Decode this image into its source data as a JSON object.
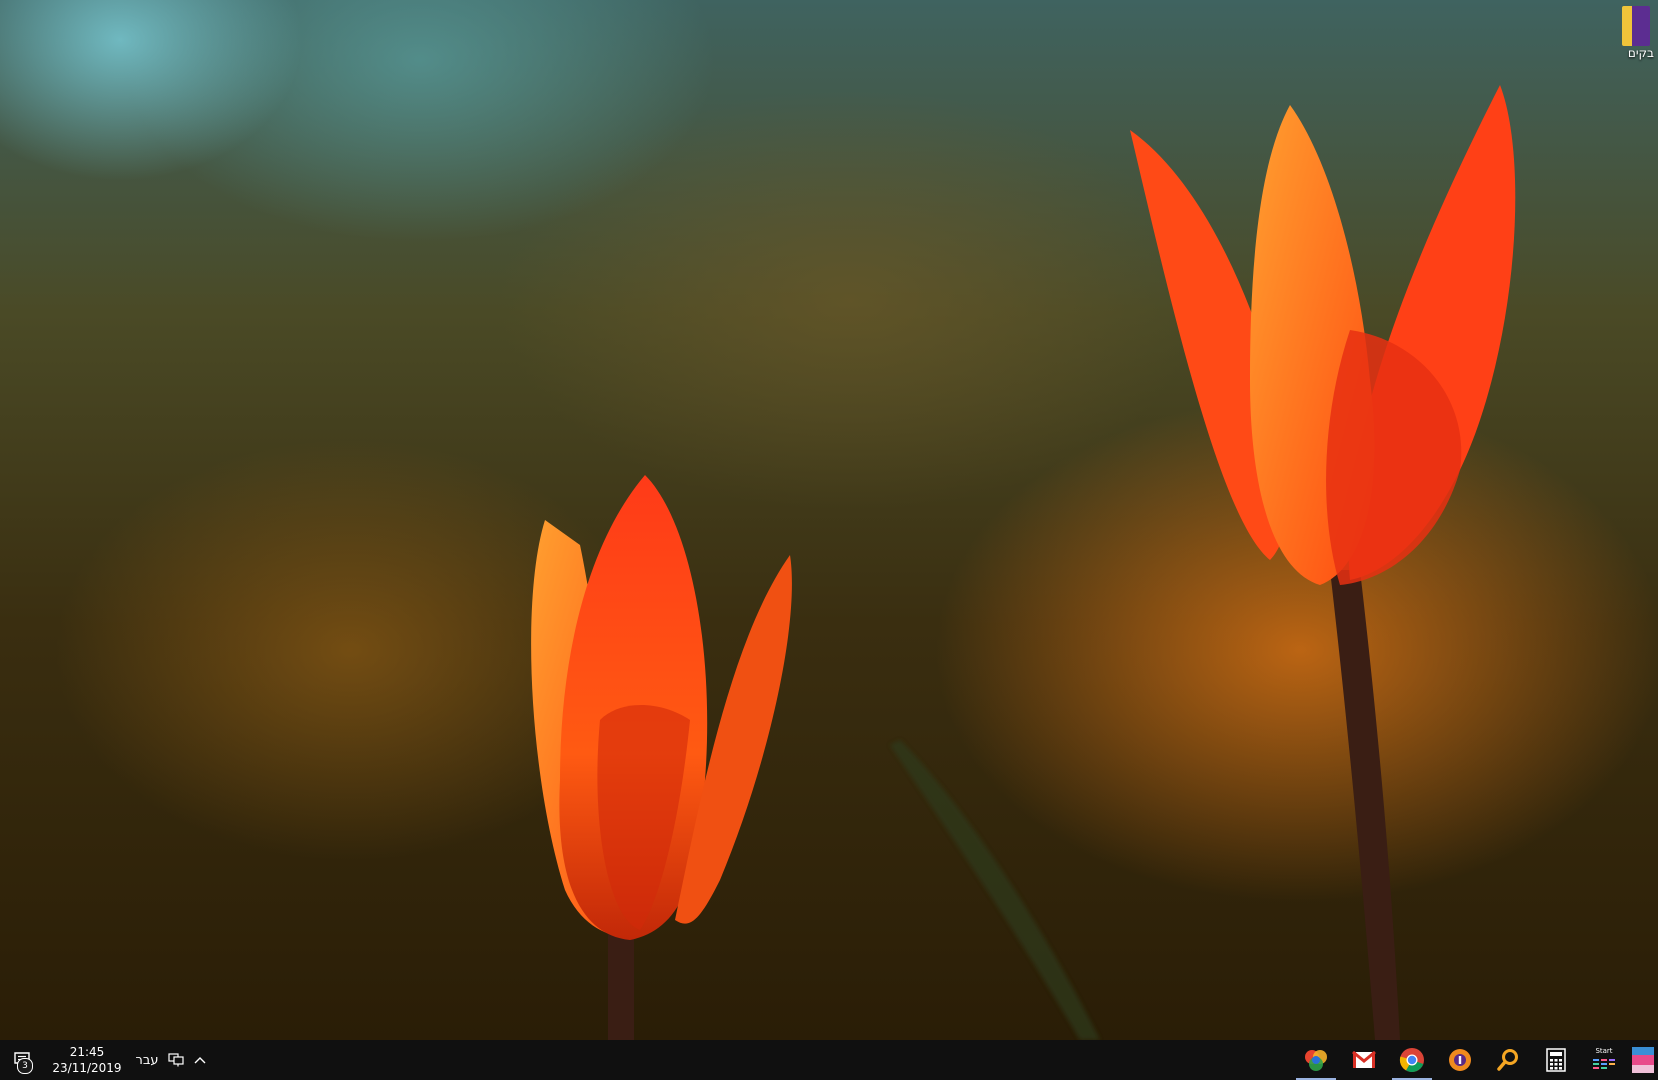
{
  "desktop": {
    "icons": [
      {
        "label": "בקים",
        "icon": "folder-app-icon"
      }
    ]
  },
  "taskbar": {
    "notifications": {
      "icon": "action-center-icon",
      "count": "3"
    },
    "clock": {
      "time": "21:45",
      "date": "23/11/2019"
    },
    "language": "עבר",
    "tray": [
      {
        "icon": "network-icon"
      },
      {
        "icon": "chevron-up-icon"
      }
    ],
    "apps": [
      {
        "name": "app-multicolor-circles",
        "active": true
      },
      {
        "name": "gmail",
        "active": false
      },
      {
        "name": "chrome",
        "active": true
      },
      {
        "name": "avast-browser",
        "active": false
      },
      {
        "name": "search",
        "active": false
      },
      {
        "name": "calculator",
        "active": false
      },
      {
        "name": "start-menu-app",
        "label": "Start",
        "active": false
      },
      {
        "name": "photo-app",
        "active": false
      }
    ]
  },
  "colors": {
    "taskbar": "#101010",
    "tulip": "#ff4a10",
    "tulip_light": "#ff8a20",
    "stem": "#3a1e14"
  }
}
